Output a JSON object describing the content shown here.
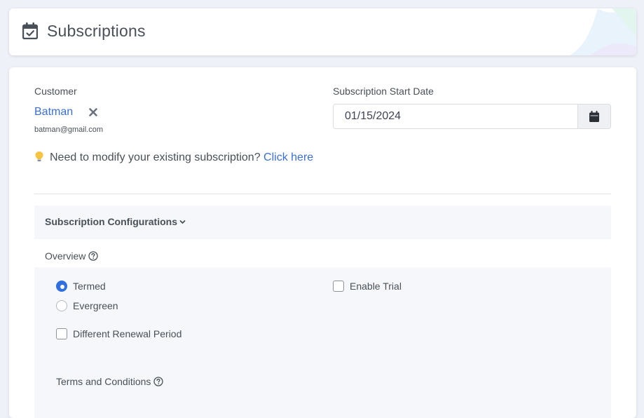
{
  "header": {
    "title": "Subscriptions",
    "icon": "calendar-check-icon"
  },
  "customer": {
    "label": "Customer",
    "name": "Batman",
    "email": "batman@gmail.com",
    "remove_icon": "close-icon"
  },
  "hint": {
    "text": "Need to modify your existing subscription?",
    "link": "Click here",
    "icon": "lightbulb-icon"
  },
  "start_date": {
    "label": "Subscription Start Date",
    "value": "01/15/2024",
    "icon": "calendar-icon"
  },
  "config": {
    "title": "Subscription Configurations",
    "icon": "chevron-down-icon"
  },
  "overview": {
    "label": "Overview",
    "options": {
      "termed": "Termed",
      "evergreen": "Evergreen",
      "enable_trial": "Enable Trial",
      "different_renewal": "Different Renewal Period"
    },
    "selected": "Termed"
  },
  "terms": {
    "label": "Terms and Conditions"
  },
  "colors": {
    "accent": "#2f6fe0",
    "link": "#3b6fd6",
    "background": "#eef1f7",
    "panel": "#f5f7fb"
  }
}
